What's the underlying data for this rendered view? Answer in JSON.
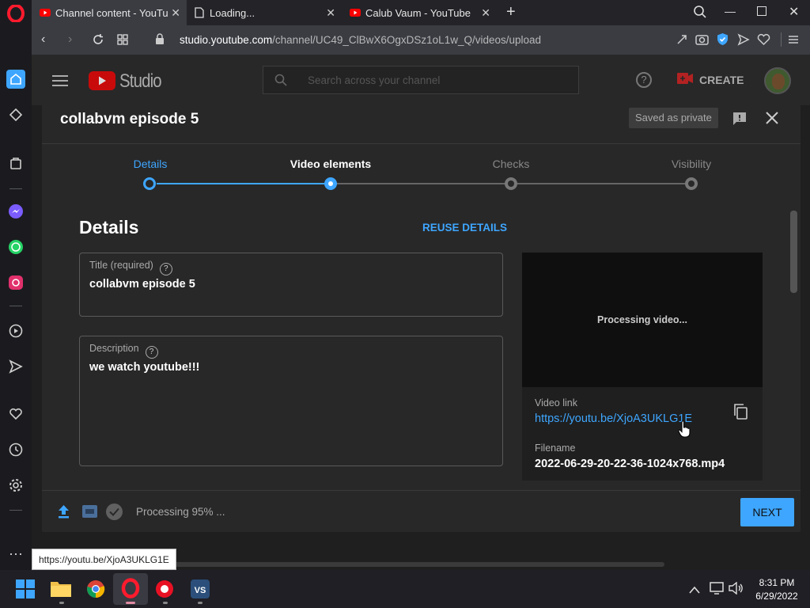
{
  "browser": {
    "tabs": [
      {
        "label": "Channel content - YouTube",
        "active": true
      },
      {
        "label": "Loading...",
        "active": false
      },
      {
        "label": "Calub Vaum - YouTube",
        "active": false
      }
    ],
    "new_tab": "+",
    "url_host": "studio.youtube.com",
    "url_path": "/channel/UC49_ClBwX6OgxDSz1oL1w_Q/videos/upload",
    "status_tooltip": "https://youtu.be/XjoA3UKLG1E"
  },
  "studio": {
    "logo_text": "Studio",
    "search_placeholder": "Search across your channel",
    "create_label": "CREATE"
  },
  "dialog": {
    "title": "collabvm episode 5",
    "saved_badge": "Saved as private",
    "steps": [
      {
        "label": "Details",
        "state": "current"
      },
      {
        "label": "Video elements",
        "state": "active"
      },
      {
        "label": "Checks",
        "state": "pending"
      },
      {
        "label": "Visibility",
        "state": "pending"
      }
    ],
    "section_title": "Details",
    "reuse_label": "REUSE DETAILS",
    "title_field": {
      "label": "Title (required)",
      "value": "collabvm episode 5"
    },
    "description_field": {
      "label": "Description",
      "value": "we watch youtube!!!"
    },
    "preview": {
      "processing_text": "Processing video...",
      "video_link_label": "Video link",
      "video_link": "https://youtu.be/XjoA3UKLG1E",
      "filename_label": "Filename",
      "filename": "2022-06-29-20-22-36-1024x768.mp4"
    },
    "footer": {
      "status": "Processing 95% ...",
      "next_label": "NEXT"
    }
  },
  "taskbar": {
    "time": "8:31 PM",
    "date": "6/29/2022"
  },
  "colors": {
    "accent_blue": "#3ea6ff",
    "youtube_red": "#ff0000",
    "opera_red": "#ff1b2d"
  }
}
